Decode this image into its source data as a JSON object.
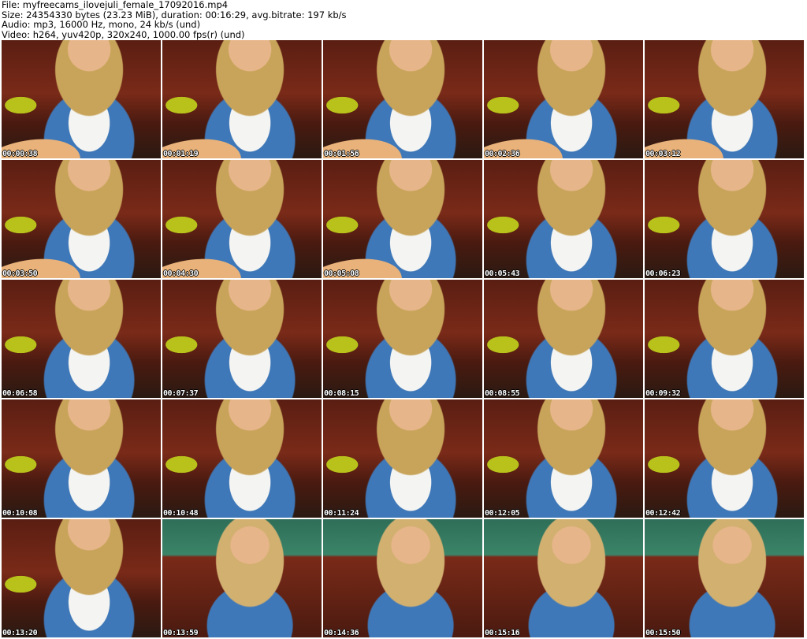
{
  "info": {
    "file": "File: myfreecams_ilovejuli_female_17092016.mp4",
    "size": "Size: 24354330 bytes (23.23 MiB), duration: 00:16:29, avg.bitrate: 197 kb/s",
    "audio": "Audio: mp3, 16000 Hz, mono, 24 kb/s (und)",
    "video": "Video: h264, yuv420p, 320x240, 1000.00 fps(r) (und)"
  },
  "thumbnails": [
    "00:00:38",
    "00:01:19",
    "00:01:56",
    "00:02:36",
    "00:03:12",
    "00:03:50",
    "00:04:30",
    "00:05:08",
    "00:05:43",
    "00:06:23",
    "00:06:58",
    "00:07:37",
    "00:08:15",
    "00:08:55",
    "00:09:32",
    "00:10:08",
    "00:10:48",
    "00:11:24",
    "00:12:05",
    "00:12:42",
    "00:13:20",
    "00:13:59",
    "00:14:36",
    "00:15:16",
    "00:15:50"
  ]
}
